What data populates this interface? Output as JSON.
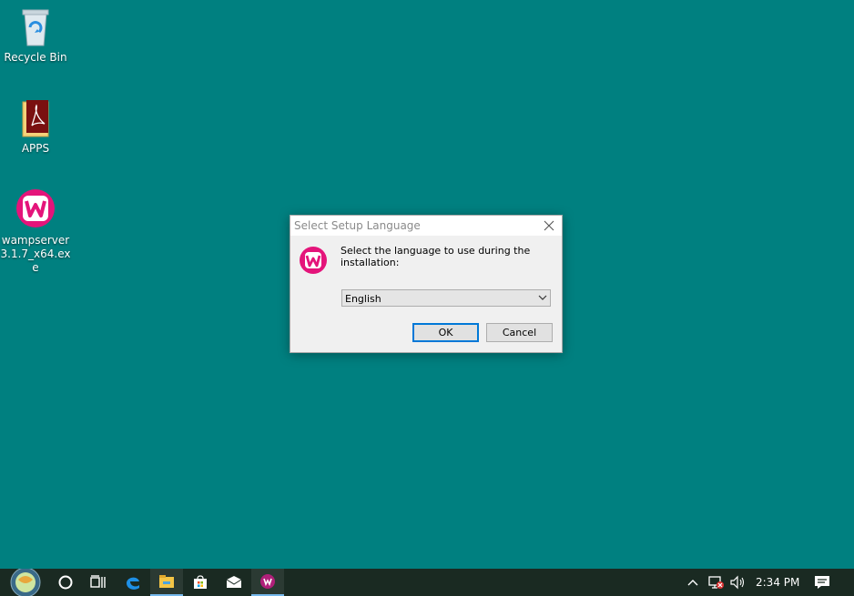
{
  "desktop": {
    "icons": [
      {
        "label": "Recycle Bin",
        "icon": "recycle-bin-icon"
      },
      {
        "label": "APPS",
        "icon": "folder-icon"
      },
      {
        "label": "wampserver3.1.7_x64.exe",
        "icon": "wampserver-icon"
      }
    ]
  },
  "dialog": {
    "title": "Select Setup Language",
    "prompt": "Select the language to use during the installation:",
    "language_selected": "English",
    "ok_label": "OK",
    "cancel_label": "Cancel"
  },
  "taskbar": {
    "items": [
      "start-icon",
      "cortana-icon",
      "task-view-icon",
      "edge-icon",
      "file-explorer-icon",
      "store-icon",
      "mail-icon",
      "wampserver-icon"
    ],
    "clock": "2:34 PM"
  },
  "colors": {
    "desktop": "#008080",
    "wamp_pink": "#e4147a",
    "focus_blue": "#0078d7"
  }
}
